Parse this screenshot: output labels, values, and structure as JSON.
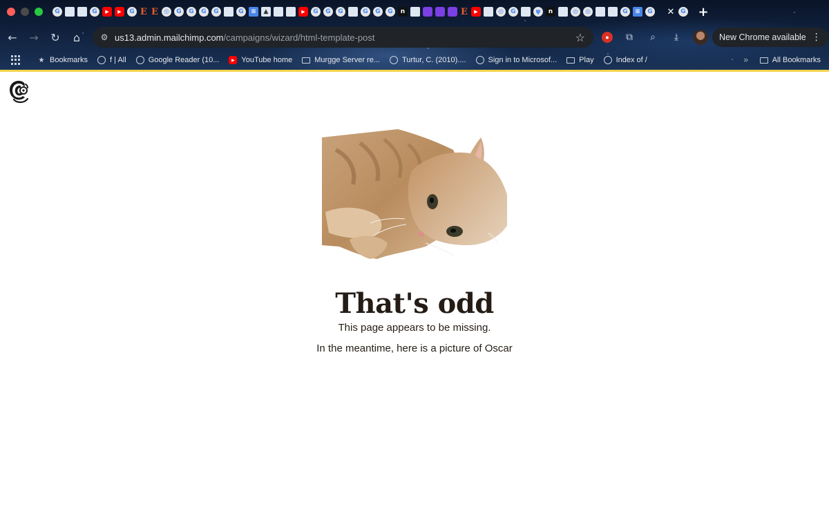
{
  "browser": {
    "tab_favicons": [
      "G",
      "E",
      "E",
      "G",
      "G",
      "G",
      "G",
      "n",
      "G",
      "G",
      "G",
      "G",
      "G",
      "G",
      "G",
      "n",
      "E",
      "G",
      "G"
    ],
    "toolbar": {
      "back_icon": "arrow-left-icon",
      "forward_icon": "arrow-right-icon",
      "reload_icon": "reload-icon",
      "home_icon": "home-icon",
      "url_host": "us13.admin.mailchimp.com",
      "url_path": "/campaigns/wizard/html-template-post",
      "update_label": "New Chrome available"
    },
    "bookmarks": [
      {
        "label": "Bookmarks",
        "icon": "star-icon"
      },
      {
        "label": "f | All",
        "icon": "globe-icon"
      },
      {
        "label": "Google Reader (10...",
        "icon": "globe-icon"
      },
      {
        "label": "YouTube home",
        "icon": "youtube-icon"
      },
      {
        "label": "Murgge Server re...",
        "icon": "folder-icon"
      },
      {
        "label": "Turtur, C. (2010)....",
        "icon": "image-icon"
      },
      {
        "label": "Sign in to Microsof...",
        "icon": "globe-icon"
      },
      {
        "label": "Play",
        "icon": "folder-icon"
      },
      {
        "label": "Index of /",
        "icon": "globe-icon"
      }
    ],
    "all_bookmarks_label": "All Bookmarks",
    "accent_color": "#f3d34a"
  },
  "page": {
    "title": "That's odd",
    "subtitle": "This page appears to be missing.",
    "body": "In the meantime, here is a picture of Oscar",
    "text_color": "#241c15"
  }
}
